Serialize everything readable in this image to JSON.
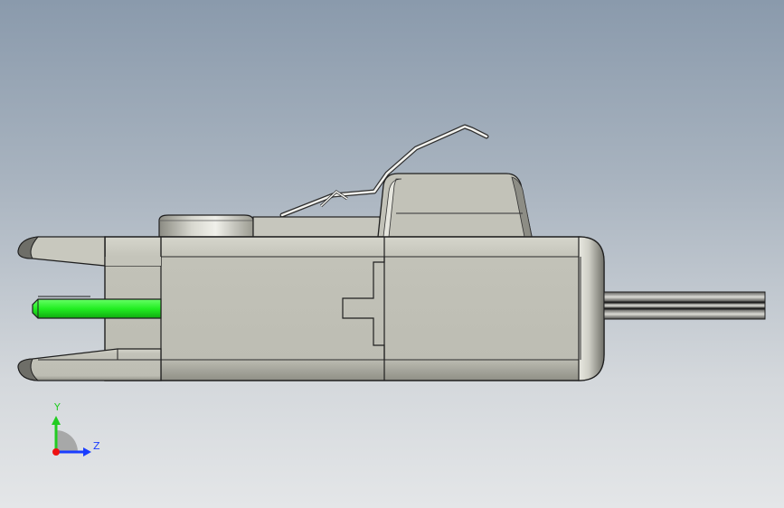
{
  "viewport": {
    "background_top": "#8a9aac",
    "background_bottom": "#e4e6e8",
    "model_color": "#bfbfb5",
    "highlight_color": "#22ee22"
  },
  "triad": {
    "y_label": "Y",
    "z_label": "Z",
    "y_color": "#22cc22",
    "z_color": "#1a3dff",
    "x_color": "#ee1111"
  }
}
